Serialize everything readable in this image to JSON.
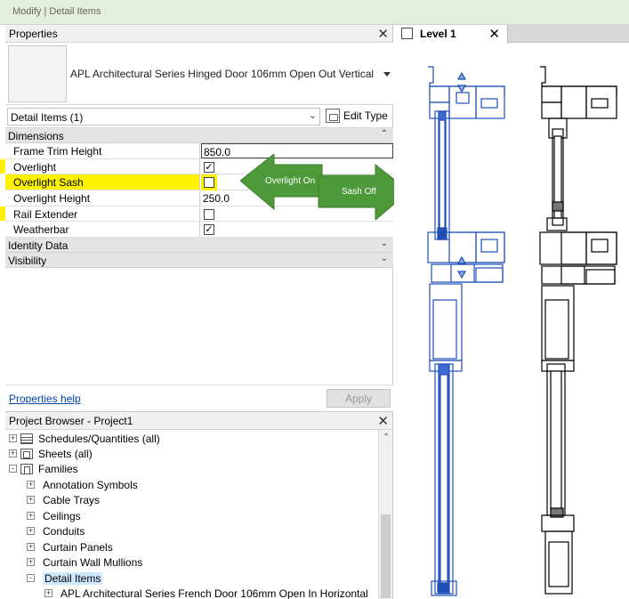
{
  "ribbon": {
    "context_label": "Modify | Detail Items"
  },
  "properties": {
    "title": "Properties",
    "type_name": "APL Architectural Series Hinged Door 106mm Open Out Vertical",
    "instance_selector": "Detail Items (1)",
    "edit_type_label": "Edit Type",
    "groups": [
      {
        "label": "Dimensions"
      },
      {
        "label": "Identity Data"
      },
      {
        "label": "Visibility"
      }
    ],
    "rows": [
      {
        "name": "Frame Trim Height",
        "value": "850.0"
      },
      {
        "name": "Overlight",
        "checked": true
      },
      {
        "name": "Overlight Sash",
        "checked": false
      },
      {
        "name": "Overlight Height",
        "value": "250.0"
      },
      {
        "name": "Rail Extender",
        "checked": false
      },
      {
        "name": "Weatherbar",
        "checked": true
      }
    ],
    "annotation": {
      "left_text": "Overlight On",
      "right_text": "Sash Off",
      "color": "#4e9a3a"
    },
    "help_link": "Properties help",
    "apply_label": "Apply"
  },
  "project_browser": {
    "title": "Project Browser - Project1",
    "items": [
      {
        "label": "Schedules/Quantities (all)",
        "expander": "+",
        "icon": "schedule-icon"
      },
      {
        "label": "Sheets (all)",
        "expander": "+",
        "icon": "sheet-icon"
      },
      {
        "label": "Families",
        "expander": "-",
        "icon": "family-icon"
      },
      {
        "label": "Annotation Symbols",
        "expander": "+"
      },
      {
        "label": "Cable Trays",
        "expander": "+"
      },
      {
        "label": "Ceilings",
        "expander": "+"
      },
      {
        "label": "Conduits",
        "expander": "+"
      },
      {
        "label": "Curtain Panels",
        "expander": "+"
      },
      {
        "label": "Curtain Wall Mullions",
        "expander": "+"
      },
      {
        "label": "Detail Items",
        "expander": "-"
      },
      {
        "label": "APL Architectural Series French Door 106mm Open In Horizontal",
        "expander": "+"
      }
    ]
  },
  "view": {
    "tab_label": "Level 1",
    "selection_color": "#1f4fb4",
    "line_color": "#000000"
  }
}
